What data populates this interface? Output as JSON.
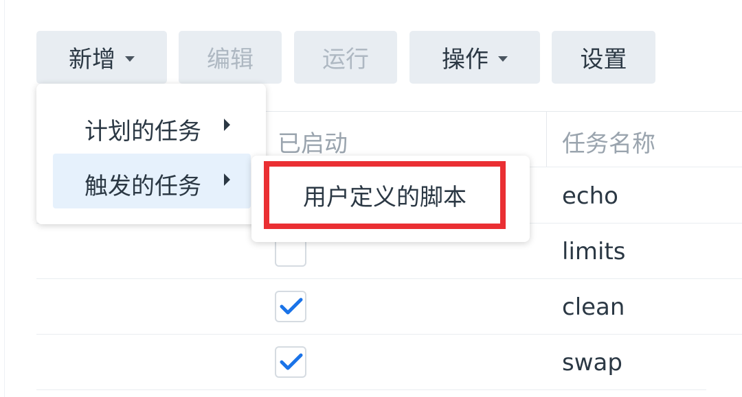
{
  "toolbar": {
    "add_label": "新增",
    "edit_label": "编辑",
    "run_label": "运行",
    "action_label": "操作",
    "settings_label": "设置"
  },
  "menu": {
    "items": [
      {
        "label": "计划的任务"
      },
      {
        "label": "触发的任务"
      }
    ],
    "submenu": {
      "items": [
        {
          "label": "用户定义的脚本"
        }
      ]
    }
  },
  "table": {
    "headers": {
      "enabled": "已启动",
      "task_name": "任务名称"
    },
    "rows": [
      {
        "name": "echo",
        "enabled": true
      },
      {
        "name": "limits",
        "enabled": false
      },
      {
        "name": "clean",
        "enabled": true
      },
      {
        "name": "swap",
        "enabled": true
      }
    ]
  },
  "colors": {
    "accent": "#1a73e8",
    "highlight_box": "#ea2f33",
    "hover": "#e6f1fc"
  }
}
